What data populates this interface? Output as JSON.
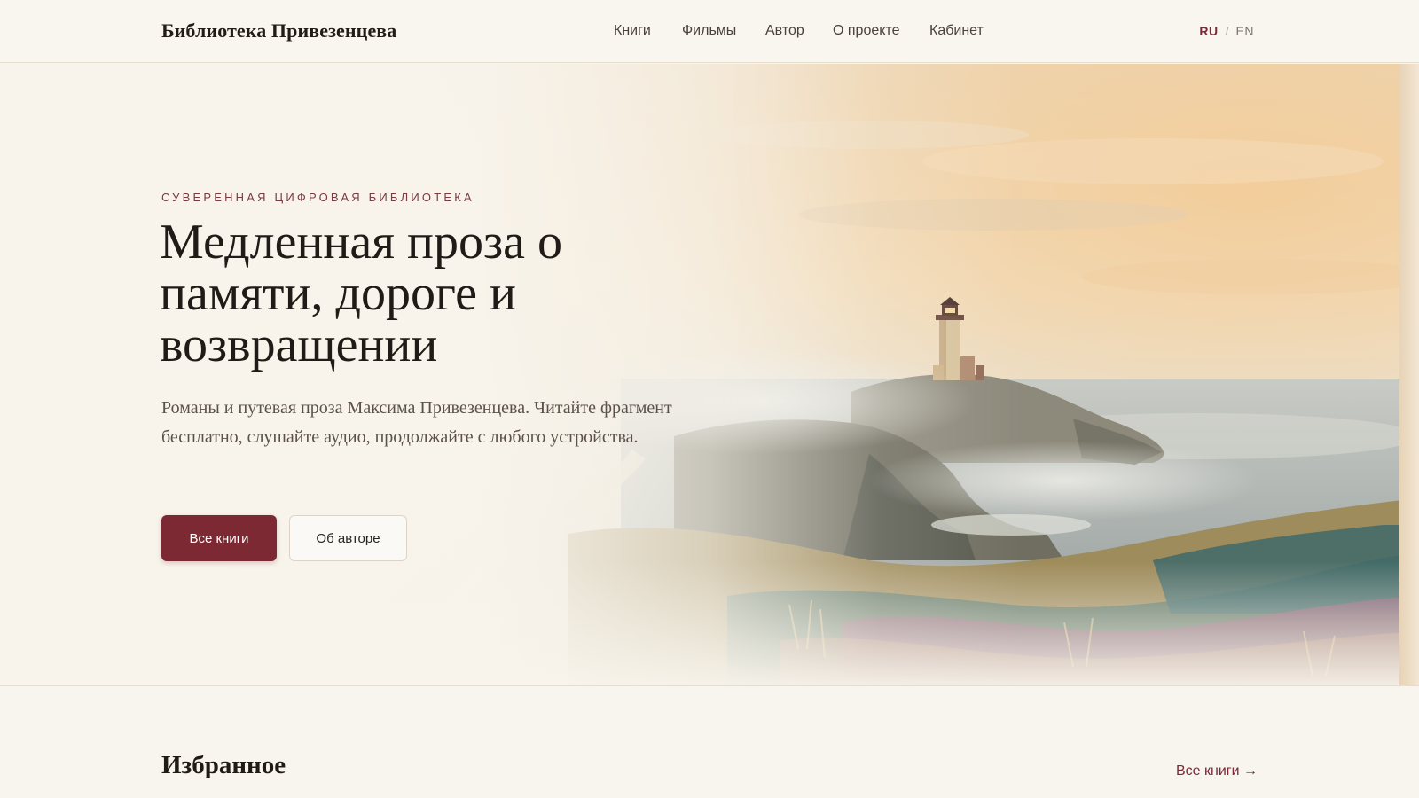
{
  "header": {
    "brand": "Библиотека Привезенцева",
    "nav": [
      "Книги",
      "Фильмы",
      "Автор",
      "О проекте",
      "Кабинет"
    ],
    "lang": {
      "active": "RU",
      "separator": "/",
      "other": "EN"
    }
  },
  "hero": {
    "eyebrow": "СУВЕРЕННАЯ ЦИФРОВАЯ БИБЛИОТЕКА",
    "title": "Медленная проза о памяти, дороге и возвращении",
    "lead": "Романы и путевая проза Максима Привезенцева. Читайте фрагмент бесплатно, слушайте аудио, продолжайте с любого устройства.",
    "primary_button": "Все книги",
    "secondary_button": "Об авторе"
  },
  "featured": {
    "title": "Избранное",
    "link": "Все книги →"
  },
  "colors": {
    "accent": "#7d2933",
    "background": "#f8f5ee",
    "text": "#211b17"
  },
  "icons": {
    "arrow": "arrow-right-icon"
  }
}
